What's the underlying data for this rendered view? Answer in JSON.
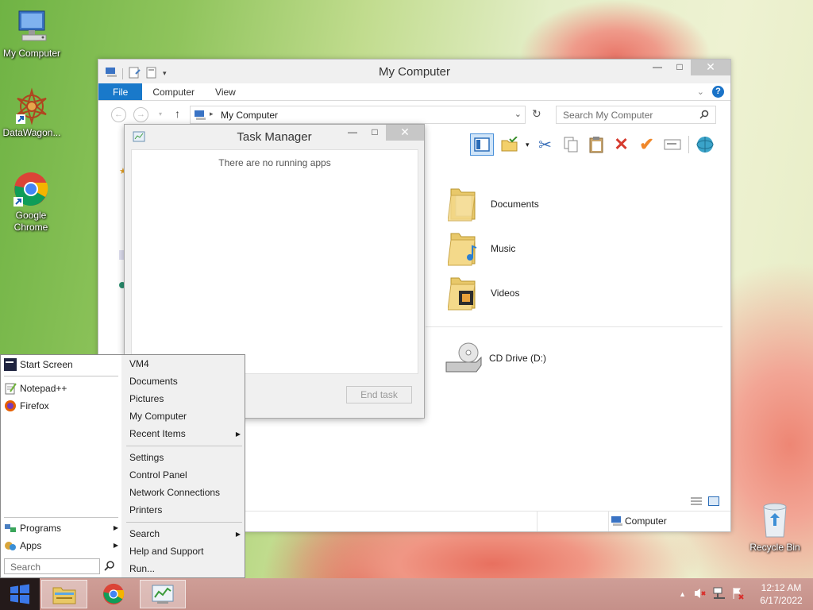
{
  "desktop": {
    "icons": [
      {
        "label": "My Computer"
      },
      {
        "label": "DataWagon..."
      },
      {
        "label": "Google Chrome"
      },
      {
        "label": "Recycle Bin"
      }
    ]
  },
  "explorer": {
    "title": "My Computer",
    "tabs": [
      {
        "label": "File"
      },
      {
        "label": "Computer"
      },
      {
        "label": "View"
      }
    ],
    "address": "My Computer",
    "search_placeholder": "Search My Computer",
    "folders": [
      {
        "label": "Documents",
        "icon": "documents-folder-icon"
      },
      {
        "label": "Music",
        "icon": "music-folder-icon"
      },
      {
        "label": "Videos",
        "icon": "videos-folder-icon"
      }
    ],
    "drives": [
      {
        "label": "CD Drive (D:)",
        "icon": "cd-drive-icon"
      }
    ],
    "status_location": "Computer"
  },
  "task_manager": {
    "title": "Task Manager",
    "empty_text": "There are no running apps",
    "end_task_label": "End task"
  },
  "start_menu": {
    "left_items": [
      {
        "label": "Start Screen"
      },
      {
        "label": "Notepad++"
      },
      {
        "label": "Firefox"
      }
    ],
    "programs_label": "Programs",
    "apps_label": "Apps",
    "search_placeholder": "Search",
    "right_items": [
      {
        "label": "VM4"
      },
      {
        "label": "Documents"
      },
      {
        "label": "Pictures"
      },
      {
        "label": "My Computer"
      },
      {
        "label": "Recent Items"
      },
      {
        "label": "Settings"
      },
      {
        "label": "Control Panel"
      },
      {
        "label": "Network Connections"
      },
      {
        "label": "Printers"
      },
      {
        "label": "Search"
      },
      {
        "label": "Help and Support"
      },
      {
        "label": "Run..."
      }
    ]
  },
  "taskbar": {
    "time": "12:12 AM",
    "date": "6/17/2022"
  },
  "colors": {
    "accent_blue": "#1979ca",
    "taskbar": "#c8938c",
    "close_red": "#d9302c"
  }
}
